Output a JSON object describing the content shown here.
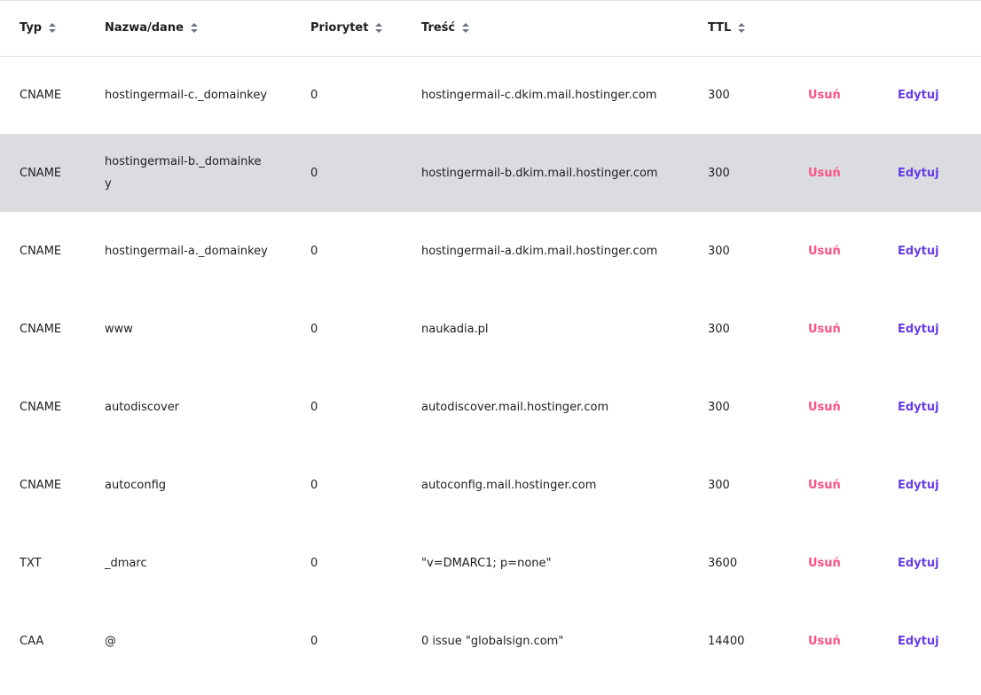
{
  "table": {
    "headers": {
      "type": "Typ",
      "name": "Nazwa/dane",
      "priority": "Priorytet",
      "content": "Treść",
      "ttl": "TTL"
    },
    "delete_label": "Usuń",
    "edit_label": "Edytuj",
    "rows": [
      {
        "type": "CNAME",
        "name": "hostingermail-c._domainkey",
        "priority": "0",
        "content": "hostingermail-c.dkim.mail.hostinger.com",
        "ttl": "300"
      },
      {
        "type": "CNAME",
        "name": "hostingermail-b._domainkey",
        "priority": "0",
        "content": "hostingermail-b.dkim.mail.hostinger.com",
        "ttl": "300"
      },
      {
        "type": "CNAME",
        "name": "hostingermail-a._domainkey",
        "priority": "0",
        "content": "hostingermail-a.dkim.mail.hostinger.com",
        "ttl": "300"
      },
      {
        "type": "CNAME",
        "name": "www",
        "priority": "0",
        "content": "naukadia.pl",
        "ttl": "300"
      },
      {
        "type": "CNAME",
        "name": "autodiscover",
        "priority": "0",
        "content": "autodiscover.mail.hostinger.com",
        "ttl": "300"
      },
      {
        "type": "CNAME",
        "name": "autoconfig",
        "priority": "0",
        "content": "autoconfig.mail.hostinger.com",
        "ttl": "300"
      },
      {
        "type": "TXT",
        "name": "_dmarc",
        "priority": "0",
        "content": "\"v=DMARC1; p=none\"",
        "ttl": "3600"
      },
      {
        "type": "CAA",
        "name": "@",
        "priority": "0",
        "content": "0 issue \"globalsign.com\"",
        "ttl": "14400"
      }
    ]
  },
  "colors": {
    "delete": "#fc5185",
    "edit": "#673de6",
    "hover_row": "#dadce0"
  }
}
